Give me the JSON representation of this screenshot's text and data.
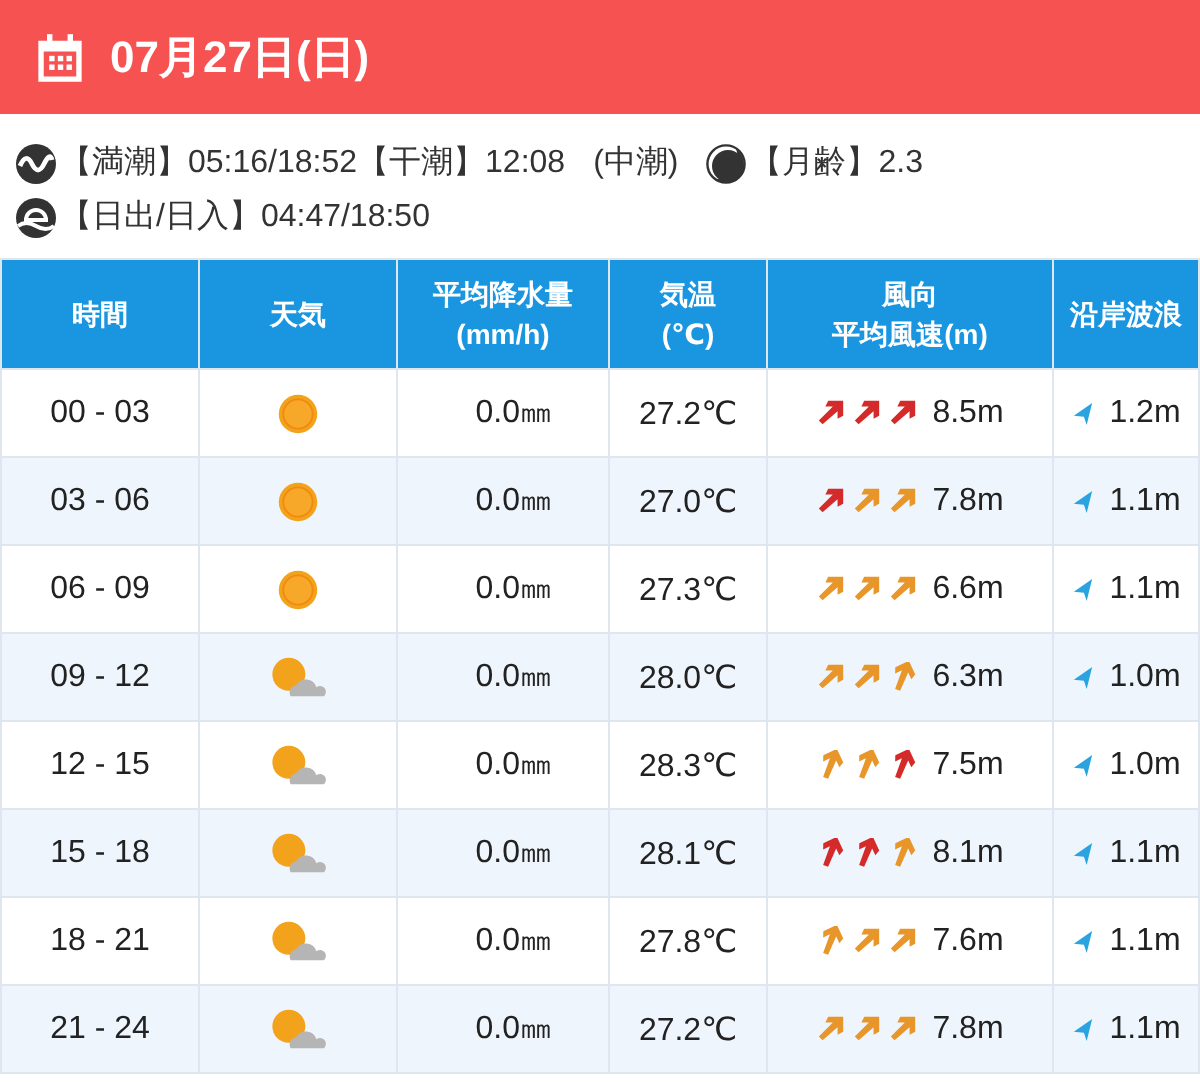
{
  "header": {
    "date": "07月27日(日)"
  },
  "info": {
    "tide_high_label": "【満潮】05:16/18:52",
    "tide_low_label": "【干潮】12:08",
    "tide_type": "(中潮)",
    "moon_age": "【月齢】2.3",
    "sun": "【日出/日入】04:47/18:50"
  },
  "table": {
    "columns": [
      [
        "時間"
      ],
      [
        "天気"
      ],
      [
        "平均降水量",
        "(mm/h)"
      ],
      [
        "気温",
        "(℃)"
      ],
      [
        "風向",
        "平均風速(m)"
      ],
      [
        "沿岸波浪"
      ]
    ],
    "rows": [
      {
        "time": "00 - 03",
        "weather": {
          "kind": "sunny"
        },
        "rain": "0.0㎜",
        "temp": "27.2℃",
        "arrows": [
          {
            "kind": "ne",
            "color": "#d42a2a"
          },
          {
            "kind": "ne",
            "color": "#d42a2a"
          },
          {
            "kind": "ne",
            "color": "#d42a2a"
          }
        ],
        "wind": "8.5m",
        "wave": "1.2m"
      },
      {
        "time": "03 - 06",
        "weather": {
          "kind": "sunny"
        },
        "rain": "0.0㎜",
        "temp": "27.0℃",
        "arrows": [
          {
            "kind": "ne",
            "color": "#d42a2a"
          },
          {
            "kind": "ne",
            "color": "#e8962a"
          },
          {
            "kind": "ne",
            "color": "#e8962a"
          }
        ],
        "wind": "7.8m",
        "wave": "1.1m"
      },
      {
        "time": "06 - 09",
        "weather": {
          "kind": "sunny"
        },
        "rain": "0.0㎜",
        "temp": "27.3℃",
        "arrows": [
          {
            "kind": "ne",
            "color": "#e8962a"
          },
          {
            "kind": "ne",
            "color": "#e8962a"
          },
          {
            "kind": "ne",
            "color": "#e8962a"
          }
        ],
        "wind": "6.6m",
        "wave": "1.1m"
      },
      {
        "time": "09 - 12",
        "weather": {
          "kind": "sunny-cloudy"
        },
        "rain": "0.0㎜",
        "temp": "28.0℃",
        "arrows": [
          {
            "kind": "ne",
            "color": "#e8962a"
          },
          {
            "kind": "ne",
            "color": "#e8962a"
          },
          {
            "kind": "nne",
            "color": "#e8962a"
          }
        ],
        "wind": "6.3m",
        "wave": "1.0m"
      },
      {
        "time": "12 - 15",
        "weather": {
          "kind": "sunny-cloudy"
        },
        "rain": "0.0㎜",
        "temp": "28.3℃",
        "arrows": [
          {
            "kind": "nne",
            "color": "#e8962a"
          },
          {
            "kind": "nne",
            "color": "#e8962a"
          },
          {
            "kind": "nne",
            "color": "#d42a2a"
          }
        ],
        "wind": "7.5m",
        "wave": "1.0m"
      },
      {
        "time": "15 - 18",
        "weather": {
          "kind": "sunny-cloudy"
        },
        "rain": "0.0㎜",
        "temp": "28.1℃",
        "arrows": [
          {
            "kind": "nne",
            "color": "#d42a2a"
          },
          {
            "kind": "nne",
            "color": "#d42a2a"
          },
          {
            "kind": "nne",
            "color": "#e8962a"
          }
        ],
        "wind": "8.1m",
        "wave": "1.1m"
      },
      {
        "time": "18 - 21",
        "weather": {
          "kind": "sunny-cloudy"
        },
        "rain": "0.0㎜",
        "temp": "27.8℃",
        "arrows": [
          {
            "kind": "nne",
            "color": "#e8962a"
          },
          {
            "kind": "ne",
            "color": "#e8962a"
          },
          {
            "kind": "ne",
            "color": "#e8962a"
          }
        ],
        "wind": "7.6m",
        "wave": "1.1m"
      },
      {
        "time": "21 - 24",
        "weather": {
          "kind": "sunny-cloudy"
        },
        "rain": "0.0㎜",
        "temp": "27.2℃",
        "arrows": [
          {
            "kind": "ne",
            "color": "#e8962a"
          },
          {
            "kind": "ne",
            "color": "#e8962a"
          },
          {
            "kind": "ne",
            "color": "#e8962a"
          }
        ],
        "wind": "7.8m",
        "wave": "1.1m"
      }
    ]
  }
}
